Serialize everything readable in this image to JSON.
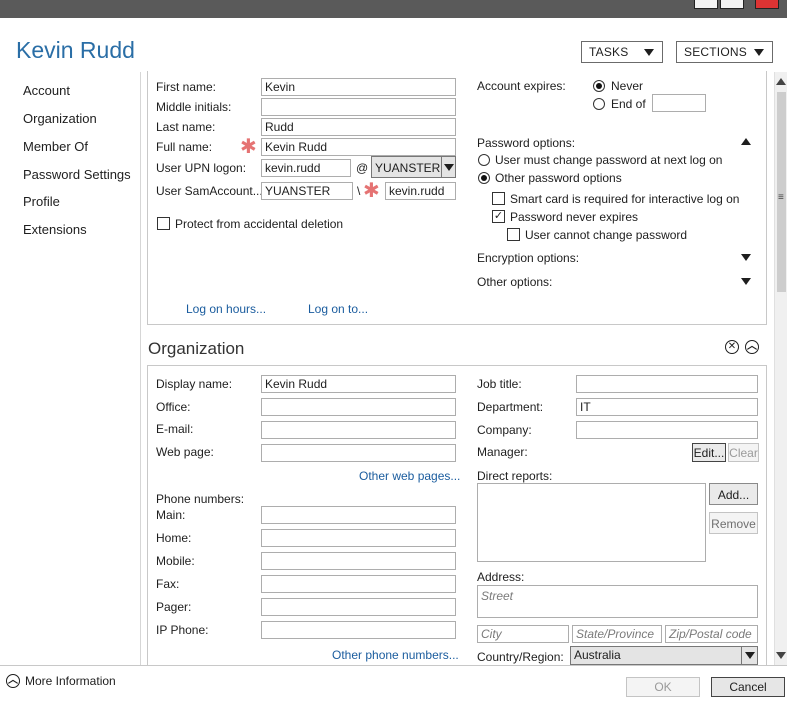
{
  "window": {
    "title": "Kevin Rudd",
    "tasks_label": "TASKS",
    "sections_label": "SECTIONS"
  },
  "sidebar": {
    "items": [
      {
        "label": "Account"
      },
      {
        "label": "Organization"
      },
      {
        "label": "Member Of"
      },
      {
        "label": "Password Settings"
      },
      {
        "label": "Profile"
      },
      {
        "label": "Extensions"
      }
    ]
  },
  "account": {
    "first_name_label": "First name:",
    "first_name_value": "Kevin",
    "middle_initials_label": "Middle initials:",
    "middle_initials_value": "",
    "last_name_label": "Last name:",
    "last_name_value": "Rudd",
    "full_name_label": "Full name:",
    "full_name_value": "Kevin Rudd",
    "upn_label": "User UPN logon:",
    "upn_value": "kevin.rudd",
    "upn_at": "@",
    "upn_domain": "YUANSTER",
    "sam_label": "User SamAccount...",
    "sam_domain": "YUANSTER",
    "sam_sep": "\\",
    "sam_value": "kevin.rudd",
    "protect_label": "Protect from accidental deletion",
    "protect_checked": false,
    "log_on_hours": "Log on hours...",
    "log_on_to": "Log on to...",
    "expires_label": "Account expires:",
    "expires_never": "Never",
    "expires_end_of": "End of",
    "expires_end_of_value": "",
    "password_options_label": "Password options:",
    "pw_must_change": "User must change password at next log on",
    "pw_other": "Other password options",
    "pw_smart_card": "Smart card is required for interactive log on",
    "pw_smart_card_checked": false,
    "pw_never_expires": "Password never expires",
    "pw_never_expires_checked": true,
    "pw_cannot_change": "User cannot change password",
    "pw_cannot_change_checked": false,
    "encryption_label": "Encryption options:",
    "other_options_label": "Other options:"
  },
  "organization": {
    "section_title": "Organization",
    "display_name_label": "Display name:",
    "display_name_value": "Kevin Rudd",
    "office_label": "Office:",
    "office_value": "",
    "email_label": "E-mail:",
    "email_value": "",
    "web_page_label": "Web page:",
    "web_page_value": "",
    "other_web_pages": "Other web pages...",
    "phone_numbers_label": "Phone numbers:",
    "main_label": "Main:",
    "home_label": "Home:",
    "mobile_label": "Mobile:",
    "fax_label": "Fax:",
    "pager_label": "Pager:",
    "ip_phone_label": "IP Phone:",
    "other_phone_numbers": "Other phone numbers...",
    "job_title_label": "Job title:",
    "job_title_value": "",
    "department_label": "Department:",
    "department_value": "IT",
    "company_label": "Company:",
    "company_value": "",
    "manager_label": "Manager:",
    "edit_button": "Edit...",
    "clear_button": "Clear",
    "direct_reports_label": "Direct reports:",
    "add_button": "Add...",
    "remove_button": "Remove",
    "address_label": "Address:",
    "street_placeholder": "Street",
    "city_placeholder": "City",
    "state_placeholder": "State/Province",
    "zip_placeholder": "Zip/Postal code",
    "country_label": "Country/Region:",
    "country_value": "Australia"
  },
  "footer": {
    "more_info": "More Information",
    "ok": "OK",
    "cancel": "Cancel"
  }
}
